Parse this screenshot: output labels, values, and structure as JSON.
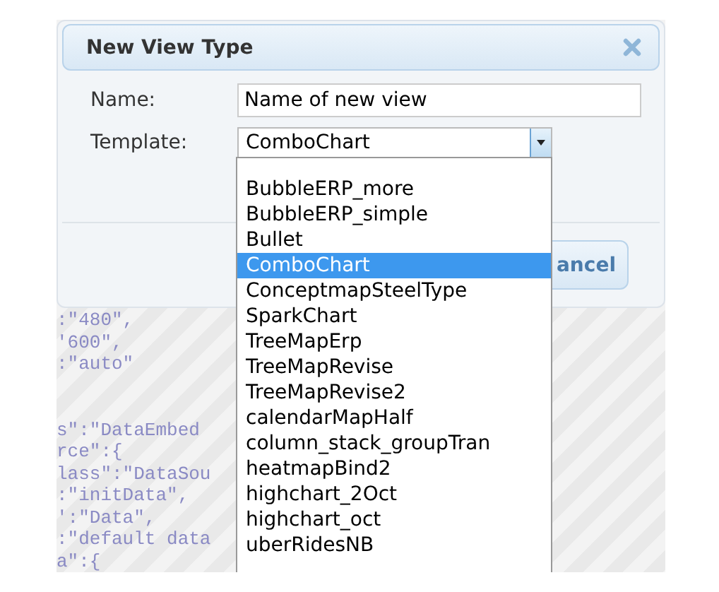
{
  "dialog": {
    "title": "New View Type",
    "fields": [
      {
        "label": "Name:",
        "value": "Name of new view"
      },
      {
        "label": "Template:",
        "value": "ComboChart"
      }
    ],
    "buttons": [
      "ancel"
    ]
  },
  "dropdown": {
    "items": [
      {
        "label": "BubbleERP_more",
        "selected": false
      },
      {
        "label": "BubbleERP_simple",
        "selected": false
      },
      {
        "label": "Bullet",
        "selected": false
      },
      {
        "label": "ComboChart",
        "selected": true
      },
      {
        "label": "ConceptmapSteelType",
        "selected": false
      },
      {
        "label": "SparkChart",
        "selected": false
      },
      {
        "label": "TreeMapErp",
        "selected": false
      },
      {
        "label": "TreeMapRevise",
        "selected": false
      },
      {
        "label": "TreeMapRevise2",
        "selected": false
      },
      {
        "label": "calendarMapHalf",
        "selected": false
      },
      {
        "label": "column_stack_groupTran",
        "selected": false
      },
      {
        "label": "heatmapBind2",
        "selected": false
      },
      {
        "label": "highchart_2Oct",
        "selected": false
      },
      {
        "label": "highchart_oct",
        "selected": false
      },
      {
        "label": "uberRidesNB",
        "selected": false
      }
    ]
  },
  "code_blocks": [
    [
      ":\"480\",",
      "'600\",",
      ":\"auto\""
    ],
    [
      "s\":\"DataEmbed",
      "rce\":{",
      "lass\":\"DataSou",
      ":\"initData\",",
      "':\"Data\",",
      ":\"default data",
      "a\":{"
    ]
  ]
}
